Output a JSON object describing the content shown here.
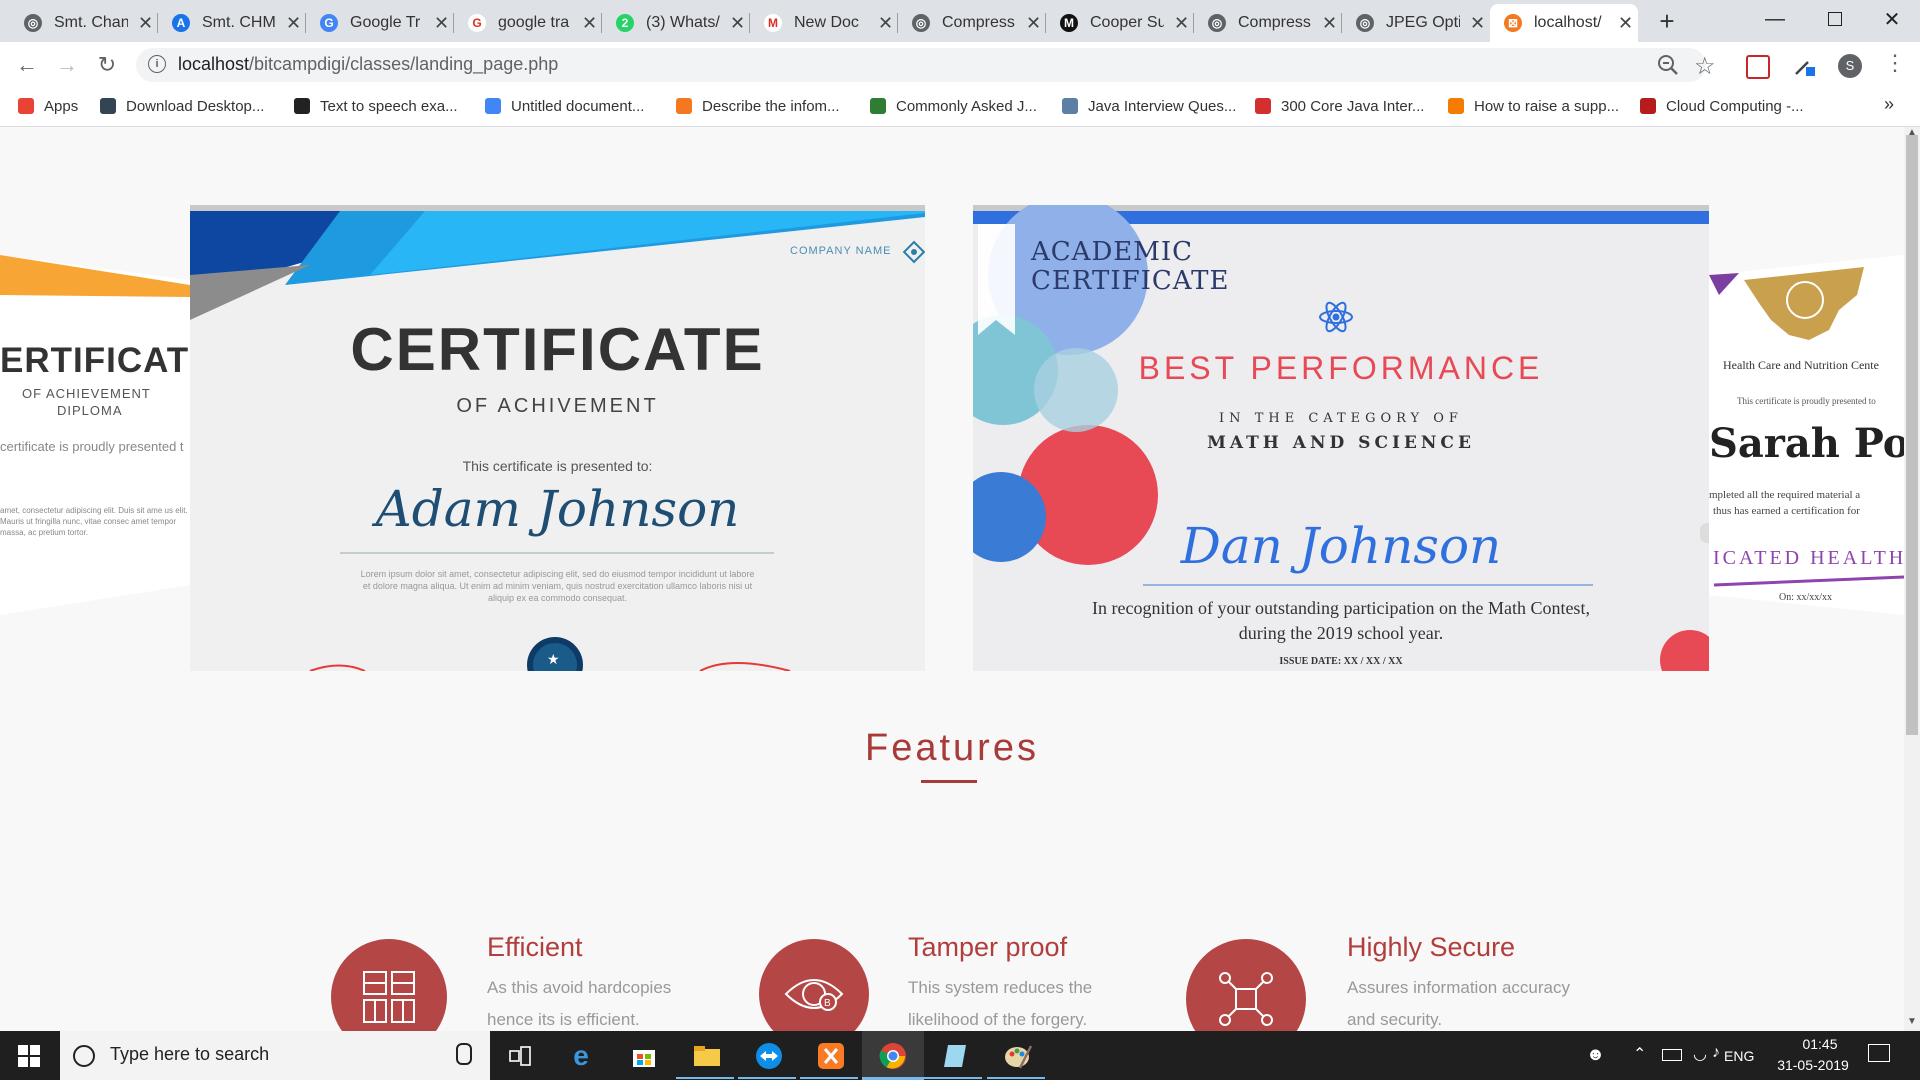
{
  "tabs": [
    {
      "label": "Smt. Chan",
      "color": "#5f6368",
      "glyph": "◎"
    },
    {
      "label": "Smt. CHM",
      "color": "#1a73e8",
      "glyph": "A"
    },
    {
      "label": "Google Tr",
      "color": "#4285f4",
      "glyph": "G"
    },
    {
      "label": "google tra",
      "color": "#ffffff",
      "glyph": "G"
    },
    {
      "label": "(3) Whats/",
      "color": "#25d366",
      "glyph": "2"
    },
    {
      "label": "New Doc",
      "color": "#ffffff",
      "glyph": "M"
    },
    {
      "label": "Compress",
      "color": "#5f6368",
      "glyph": "◎"
    },
    {
      "label": "Cooper Su",
      "color": "#111111",
      "glyph": "M"
    },
    {
      "label": "Compress",
      "color": "#5f6368",
      "glyph": "◎"
    },
    {
      "label": "JPEG Opti",
      "color": "#5f6368",
      "glyph": "◎"
    },
    {
      "label": "localhost/",
      "color": "#f4781f",
      "glyph": "⊠"
    }
  ],
  "address_bar": {
    "host": "localhost",
    "path": "/bitcampdigi/classes/landing_page.php"
  },
  "profile_initial": "S",
  "bookmarks": [
    {
      "label": "Apps",
      "color": "#ea4335"
    },
    {
      "label": "Download Desktop...",
      "color": "#334455"
    },
    {
      "label": "Text to speech exa...",
      "color": "#222222"
    },
    {
      "label": "Untitled document...",
      "color": "#4285f4"
    },
    {
      "label": "Describe the infom...",
      "color": "#f4781f"
    },
    {
      "label": "Commonly Asked J...",
      "color": "#2e7d32"
    },
    {
      "label": "Java Interview Ques...",
      "color": "#5c7fa3"
    },
    {
      "label": "300 Core Java Inter...",
      "color": "#d32f2f"
    },
    {
      "label": "How to raise a supp...",
      "color": "#f57c00"
    },
    {
      "label": "Cloud Computing -...",
      "color": "#b71c1c"
    }
  ],
  "carousel": {
    "left_partial": {
      "title": "ERTIFICATE",
      "subtitle": "OF ACHIEVEMENT",
      "subtitle2": "DIPLOMA",
      "presented": "certificate is proudly presented t",
      "lorem": "amet, consectetur adipiscing elit. Duis sit ame us elit. Mauris ut fringilla nunc, vitae consec amet tempor massa, ac pretium tortor."
    },
    "cert1": {
      "company": "COMPANY NAME",
      "title": "CERTIFICATE",
      "subtitle": "OF ACHIVEMENT",
      "presented": "This certificate is presented to:",
      "name": "Adam Johnson",
      "body": "Lorem ipsum dolor sit amet, consectetur adipiscing elit, sed do eiusmod tempor incididunt ut labore et dolore magna aliqua. Ut enim ad minim veniam, quis nostrud exercitation ullamco laboris nisi ut aliquip ex ea commodo consequat."
    },
    "cert2": {
      "heading1": "ACADEMIC",
      "heading2": "CERTIFICATE",
      "award": "BEST PERFORMANCE",
      "category_intro": "IN THE CATEGORY OF",
      "category": "MATH AND SCIENCE",
      "name": "Dan Johnson",
      "recognition1": "In recognition of your outstanding participation on the Math Contest,",
      "recognition2": "during the 2019 school year.",
      "issue": "ISSUE DATE: XX / XX / XX"
    },
    "right_partial": {
      "org": "Health Care and Nutrition Cente",
      "presented": "This certificate is proudly presented to",
      "name": "Sarah Potte",
      "body1": "mpleted all the required material a",
      "body2": "thus has earned a certification for",
      "banner": "ICATED HEALTH",
      "date": "On: xx/xx/xx"
    }
  },
  "features": {
    "title": "Features",
    "items": [
      {
        "title": "Efficient",
        "desc": "As this avoid hardcopies hence its is efficient."
      },
      {
        "title": "Tamper proof",
        "desc": "This system reduces the likelihood of the forgery."
      },
      {
        "title": "Highly Secure",
        "desc": "Assures information accuracy and security."
      }
    ]
  },
  "taskbar": {
    "search_placeholder": "Type here to search",
    "language": "ENG",
    "time": "01:45",
    "date": "31-05-2019"
  },
  "colors": {
    "accent": "#a83a3a",
    "feature_circle": "#b54646",
    "chrome_tab_strip": "#dee1e6"
  }
}
